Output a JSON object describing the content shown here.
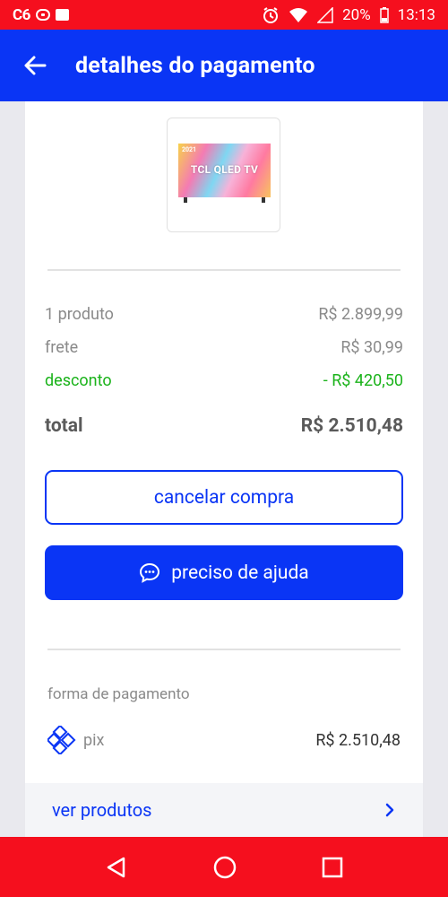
{
  "status_bar": {
    "left_text": "C6",
    "battery": "20%",
    "time": "13:13"
  },
  "header": {
    "title": "detalhes do pagamento"
  },
  "product": {
    "image_year": "2021",
    "image_brand": "TCL QLED TV"
  },
  "summary": {
    "items_label": "1 produto",
    "items_value": "R$ 2.899,99",
    "shipping_label": "frete",
    "shipping_value": "R$ 30,99",
    "discount_label": "desconto",
    "discount_value": "- R$ 420,50",
    "total_label": "total",
    "total_value": "R$ 2.510,48"
  },
  "buttons": {
    "cancel": "cancelar compra",
    "help": "preciso de ajuda"
  },
  "payment": {
    "section_title": "forma de pagamento",
    "method": "pix",
    "amount": "R$ 2.510,48"
  },
  "footer_link": {
    "label": "ver produtos"
  },
  "colors": {
    "primary": "#0a35f5",
    "status_bar": "#f50f1e",
    "discount": "#1bb31b"
  }
}
